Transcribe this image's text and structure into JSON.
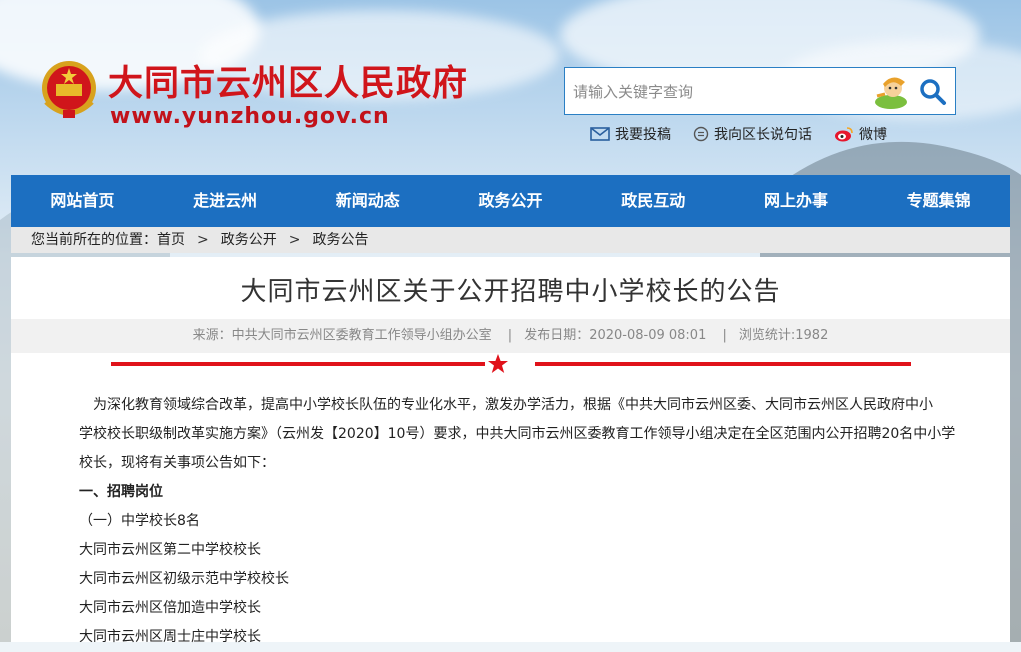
{
  "header": {
    "site_title": "大同市云州区人民政府",
    "site_url": "www.yunzhou.gov.cn",
    "search_placeholder": "请输入关键字查询",
    "quick_links": [
      "我要投稿",
      "我向区长说句话",
      "微博"
    ]
  },
  "nav": [
    "网站首页",
    "走进云州",
    "新闻动态",
    "政务公开",
    "政民互动",
    "网上办事",
    "专题集锦"
  ],
  "breadcrumb": {
    "prefix": "您当前所在的位置：",
    "items": [
      "首页",
      "政务公开",
      "政务公告"
    ],
    "separator": ">"
  },
  "article": {
    "title": "大同市云州区关于公开招聘中小学校长的公告",
    "source": "来源：中共大同市云州区委教育工作领导小组办公室",
    "date": "发布日期：2020-08-09 08:01",
    "views": "浏览统计:1982",
    "meta_separator": "|",
    "paragraphs": [
      "为深化教育领域综合改革，提高中小学校长队伍的专业化水平，激发办学活力，根据《中共大同市云州区委、大同市云州区人民政府中小",
      "学校校长职级制改革实施方案》（云州发【2020】10号）要求，中共大同市云州区委教育工作领导小组决定在全区范围内公开招聘20名中小学",
      "校长，现将有关事项公告如下："
    ],
    "section_1": "一、招聘岗位",
    "sub_1": "（一）中学校长8名",
    "positions": [
      "大同市云州区第二中学校校长",
      "大同市云州区初级示范中学校校长",
      "大同市云州区倍加造中学校长",
      "大同市云州区周士庄中学校长"
    ]
  },
  "colors": {
    "brand_red": "#d0151b",
    "nav_blue": "#1c6fc1"
  }
}
